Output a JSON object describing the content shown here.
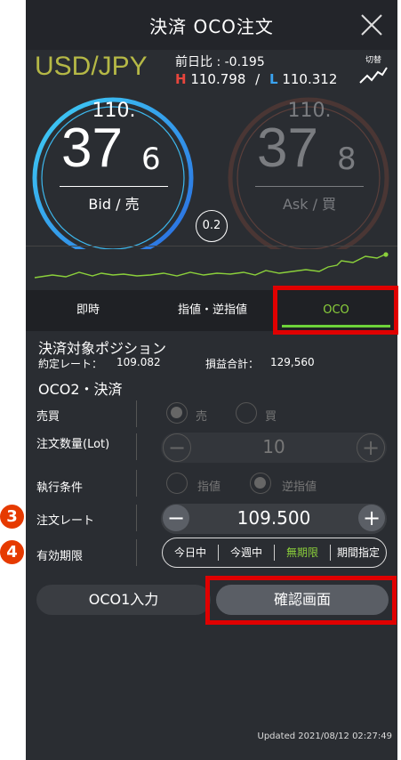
{
  "header": {
    "title": "決済 OCO注文"
  },
  "pair": "USD/JPY",
  "prev_change": "前日比 : -0.195",
  "high_low": {
    "h_label": "H",
    "h_value": "110.798",
    "sep": "/",
    "l_label": "L",
    "l_value": "110.312"
  },
  "switch_label": "切替",
  "bid": {
    "prefix": "110.",
    "main": "37",
    "sub": "6",
    "label": "Bid / 売"
  },
  "ask": {
    "prefix": "110.",
    "main": "37",
    "sub": "8",
    "label": "Ask / 買"
  },
  "spread": "0.2",
  "tabs": [
    {
      "label": "即時"
    },
    {
      "label": "指値・逆指値"
    },
    {
      "label": "OCO"
    }
  ],
  "position": {
    "title": "決済対象ポジション",
    "rate_label": "約定レート：",
    "rate_value": "109.082",
    "pl_label": "損益合計：",
    "pl_value": "129,560"
  },
  "oco_section": "OCO2・決済",
  "rows": {
    "side": {
      "label": "売買",
      "opt1": "売",
      "opt2": "買"
    },
    "qty": {
      "label": "注文数量(Lot)",
      "value": "10"
    },
    "cond": {
      "label": "執行条件",
      "opt1": "指値",
      "opt2": "逆指値"
    },
    "rate": {
      "label": "注文レート",
      "value": "109.500"
    },
    "expiry": {
      "label": "有効期限",
      "opts": [
        "今日中",
        "今週中",
        "無期限",
        "期間指定"
      ]
    }
  },
  "buttons": {
    "oco1": "OCO1入力",
    "confirm": "確認画面"
  },
  "updated": "Updated  2021/08/12 02:27:49",
  "badges": {
    "b3": "3",
    "b4": "4"
  },
  "colors": {
    "accent_green": "#8bd03b",
    "high_red": "#e8453c",
    "low_blue": "#3aa3f0",
    "highlight_red": "#e00000"
  }
}
